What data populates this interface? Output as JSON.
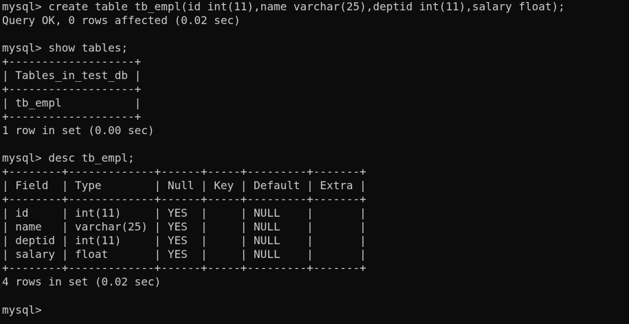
{
  "terminal": {
    "lines": [
      "mysql> create table tb_empl(id int(11),name varchar(25),deptid int(11),salary float);",
      "Query OK, 0 rows affected (0.02 sec)",
      "",
      "mysql> show tables;",
      "+-------------------+",
      "| Tables_in_test_db |",
      "+-------------------+",
      "| tb_empl           |",
      "+-------------------+",
      "1 row in set (0.00 sec)",
      "",
      "mysql> desc tb_empl;",
      "+--------+-------------+------+-----+---------+-------+",
      "| Field  | Type        | Null | Key | Default | Extra |",
      "+--------+-------------+------+-----+---------+-------+",
      "| id     | int(11)     | YES  |     | NULL    |       |",
      "| name   | varchar(25) | YES  |     | NULL    |       |",
      "| deptid | int(11)     | YES  |     | NULL    |       |",
      "| salary | float       | YES  |     | NULL    |       |",
      "+--------+-------------+------+-----+---------+-------+",
      "4 rows in set (0.02 sec)",
      "",
      "mysql> "
    ]
  },
  "colors": {
    "background": "#0c0c0c",
    "foreground": "#cccccc"
  }
}
